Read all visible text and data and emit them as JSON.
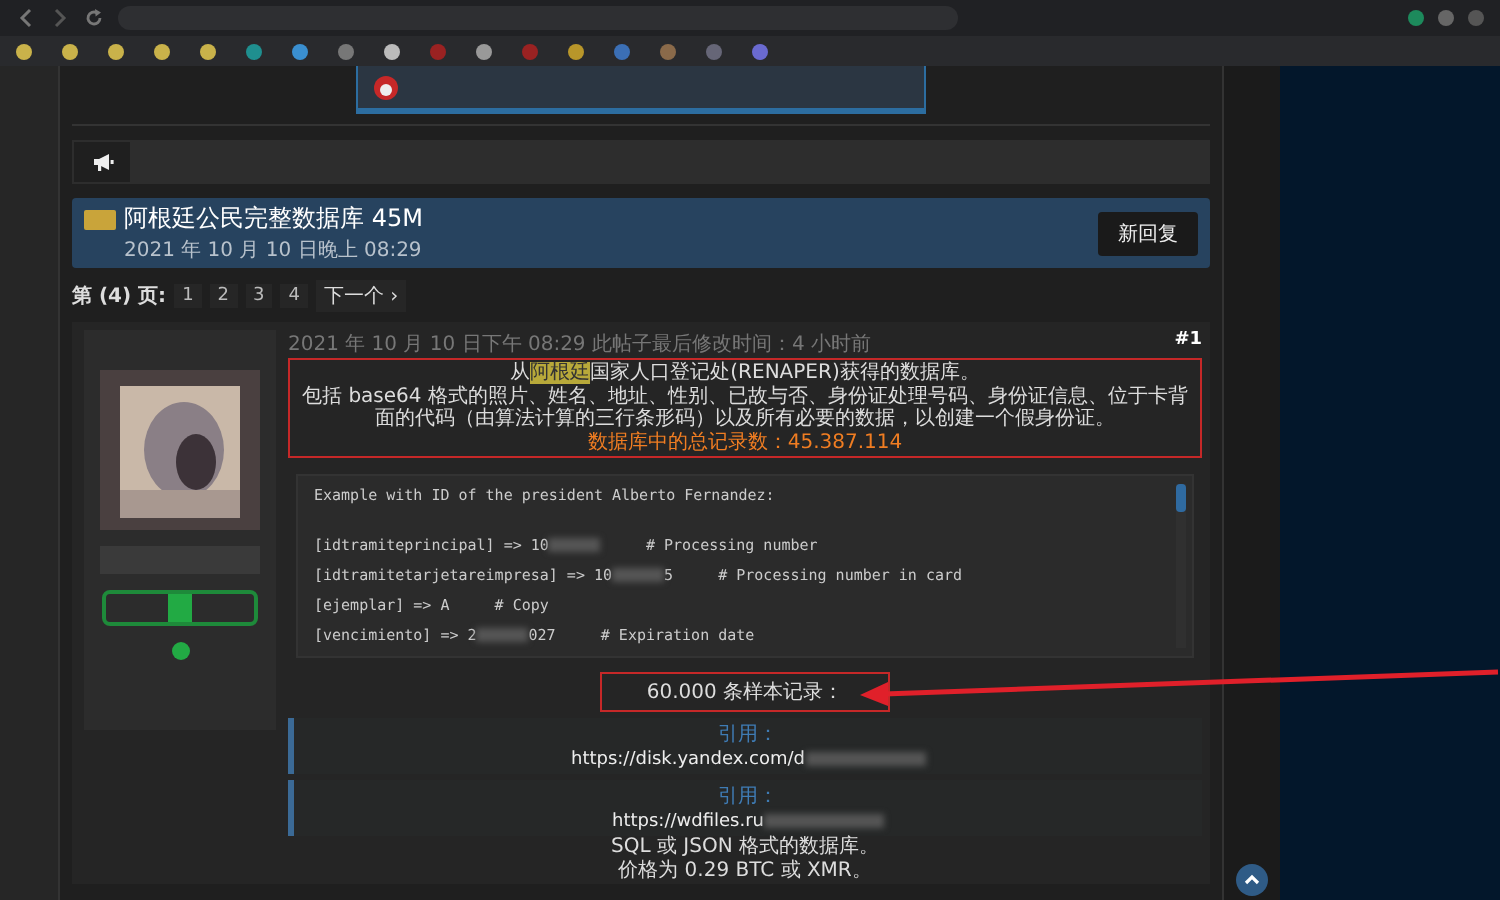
{
  "thread": {
    "title": "阿根廷公民完整数据库 45M",
    "date": "2021 年 10 月 10 日晚上 08:29",
    "reply_button": "新回复"
  },
  "pagination": {
    "label": "第 (4) 页:",
    "pages": [
      "1",
      "2",
      "3",
      "4"
    ],
    "next": "下一个 ›"
  },
  "post": {
    "meta": "2021 年 10 月 10 日下午 08:29 此帖子最后修改时间：4 小时前",
    "number": "#1",
    "source_line": {
      "before": "从",
      "highlight": "阿根廷",
      "after": "国家人口登记处(RENAPER)获得的数据库。"
    },
    "description": "包括 base64 格式的照片、姓名、地址、性别、已故与否、身份证处理号码、身份证信息、位于卡背面的代码（由算法计算的三行条形码）以及所有必要的数据，以创建一个假身份证。",
    "total": "数据库中的总记录数：45.387.114",
    "code": {
      "caption": "Example with ID of the president Alberto Fernandez:",
      "lines": [
        {
          "text": "[idtramiteprincipal] => 10",
          "redacted": true,
          "comment": "# Processing number"
        },
        {
          "text": "[idtramitetarjetareimpresa] => 10",
          "redacted": true,
          "tail": "5",
          "comment": "# Processing number in card"
        },
        {
          "text": "[ejemplar] => A",
          "redacted": false,
          "comment": "# Copy"
        },
        {
          "text": "[vencimiento] => 2",
          "redacted": true,
          "tail": "027",
          "comment": "# Expiration date"
        }
      ]
    },
    "sample_label": "60.000 条样本记录：",
    "quotes": [
      {
        "label": "引用：",
        "url": "https://disk.yandex.com/d",
        "redacted": true
      },
      {
        "label": "引用：",
        "url": "https://wdfiles.ru",
        "redacted": true
      }
    ],
    "footer_lines": [
      "SQL 或 JSON 格式的数据库。",
      "价格为 0.29 BTC 或 XMR。"
    ]
  }
}
